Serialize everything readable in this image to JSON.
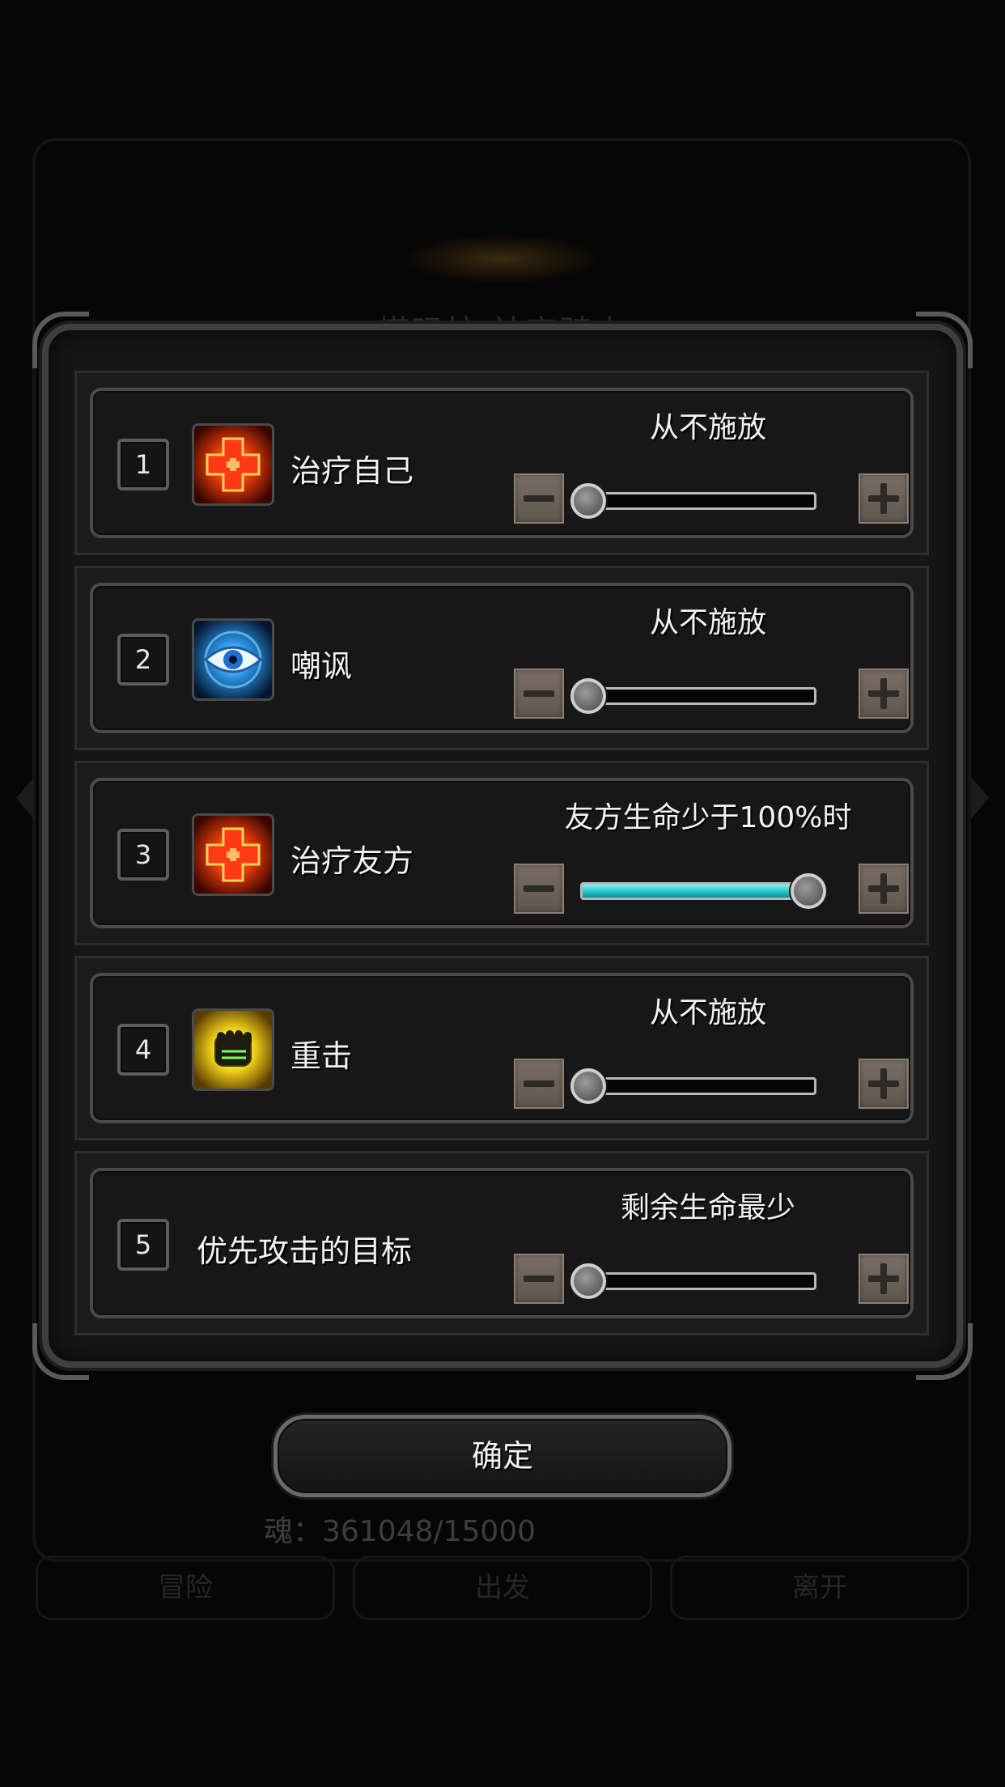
{
  "background": {
    "title": "塔玛拉 神宫骑士",
    "soul_label": "魂：361048/15000",
    "tabs": [
      "冒险",
      "出发",
      "离开"
    ]
  },
  "rows": [
    {
      "number": "1",
      "icon": "heal-cross-icon",
      "name": "治疗自己",
      "mode": "从不施放",
      "slider_fraction": 0.0
    },
    {
      "number": "2",
      "icon": "eye-taunt-icon",
      "name": "嘲讽",
      "mode": "从不施放",
      "slider_fraction": 0.0
    },
    {
      "number": "3",
      "icon": "heal-cross-icon",
      "name": "治疗友方",
      "mode": "友方生命少于100%时",
      "slider_fraction": 1.0
    },
    {
      "number": "4",
      "icon": "fist-strike-icon",
      "name": "重击",
      "mode": "从不施放",
      "slider_fraction": 0.0
    },
    {
      "number": "5",
      "icon": "",
      "name": "优先攻击的目标",
      "mode": "剩余生命最少",
      "slider_fraction": 0.0
    }
  ],
  "confirm_label": "确定",
  "colors": {
    "slider_fill": "#2cc8cc",
    "stepper": "#6b6158",
    "text": "#f2f2f2"
  }
}
